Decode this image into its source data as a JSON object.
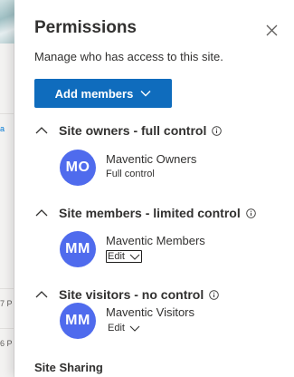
{
  "background": {
    "fragment_link": "a",
    "fragment_time_1": "7 P",
    "fragment_time_2": "6 P"
  },
  "panel": {
    "title": "Permissions",
    "subtitle": "Manage who has access to this site.",
    "add_members_label": "Add members",
    "sections": [
      {
        "label": "Site owners - full control",
        "member": {
          "initials": "MO",
          "name": "Maventic Owners",
          "role": "Full control"
        }
      },
      {
        "label": "Site members - limited control",
        "member": {
          "initials": "MM",
          "name": "Maventic Members",
          "role": "Edit"
        }
      },
      {
        "label": "Site visitors - no control",
        "member": {
          "initials": "MM",
          "name": "Maventic Visitors",
          "role": "Edit"
        }
      }
    ],
    "site_sharing_label": "Site Sharing"
  },
  "colors": {
    "primary_button": "#0f6cbd",
    "avatar": "#4f6bed",
    "text": "#323130"
  }
}
